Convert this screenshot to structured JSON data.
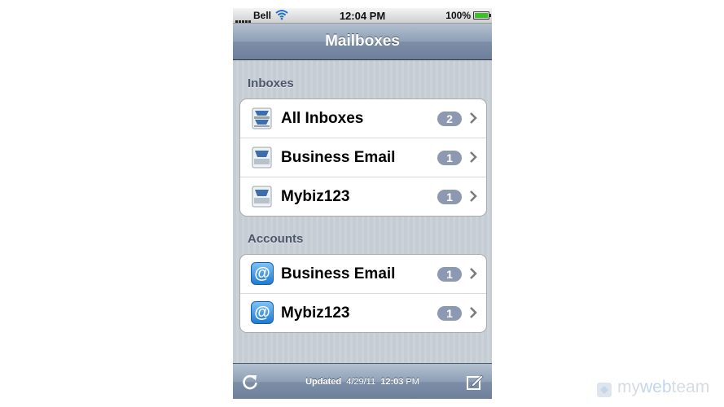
{
  "status_bar": {
    "carrier": "Bell",
    "time": "12:04 PM",
    "battery_percent": "100%",
    "battery_level": 1.0
  },
  "nav": {
    "title": "Mailboxes"
  },
  "inboxes": {
    "header": "Inboxes",
    "items": [
      {
        "label": "All Inboxes",
        "count": "2",
        "icon": "all-inboxes-tray-icon"
      },
      {
        "label": "Business Email",
        "count": "1",
        "icon": "inbox-tray-icon"
      },
      {
        "label": "Mybiz123",
        "count": "1",
        "icon": "inbox-tray-icon"
      }
    ]
  },
  "accounts": {
    "header": "Accounts",
    "items": [
      {
        "label": "Business Email",
        "count": "1",
        "icon": "at-icon"
      },
      {
        "label": "Mybiz123",
        "count": "1",
        "icon": "at-icon"
      }
    ]
  },
  "toolbar": {
    "updated_label": "Updated",
    "updated_date": "4/29/11",
    "updated_time": "12:03",
    "updated_ampm": "PM"
  },
  "watermark": {
    "my": "my",
    "web": "web",
    "team": "team"
  },
  "colors": {
    "badge": "#8c99b1",
    "nav_bar": "#8e9fb6",
    "section_header": "#4c566c"
  },
  "at_glyph": "@"
}
